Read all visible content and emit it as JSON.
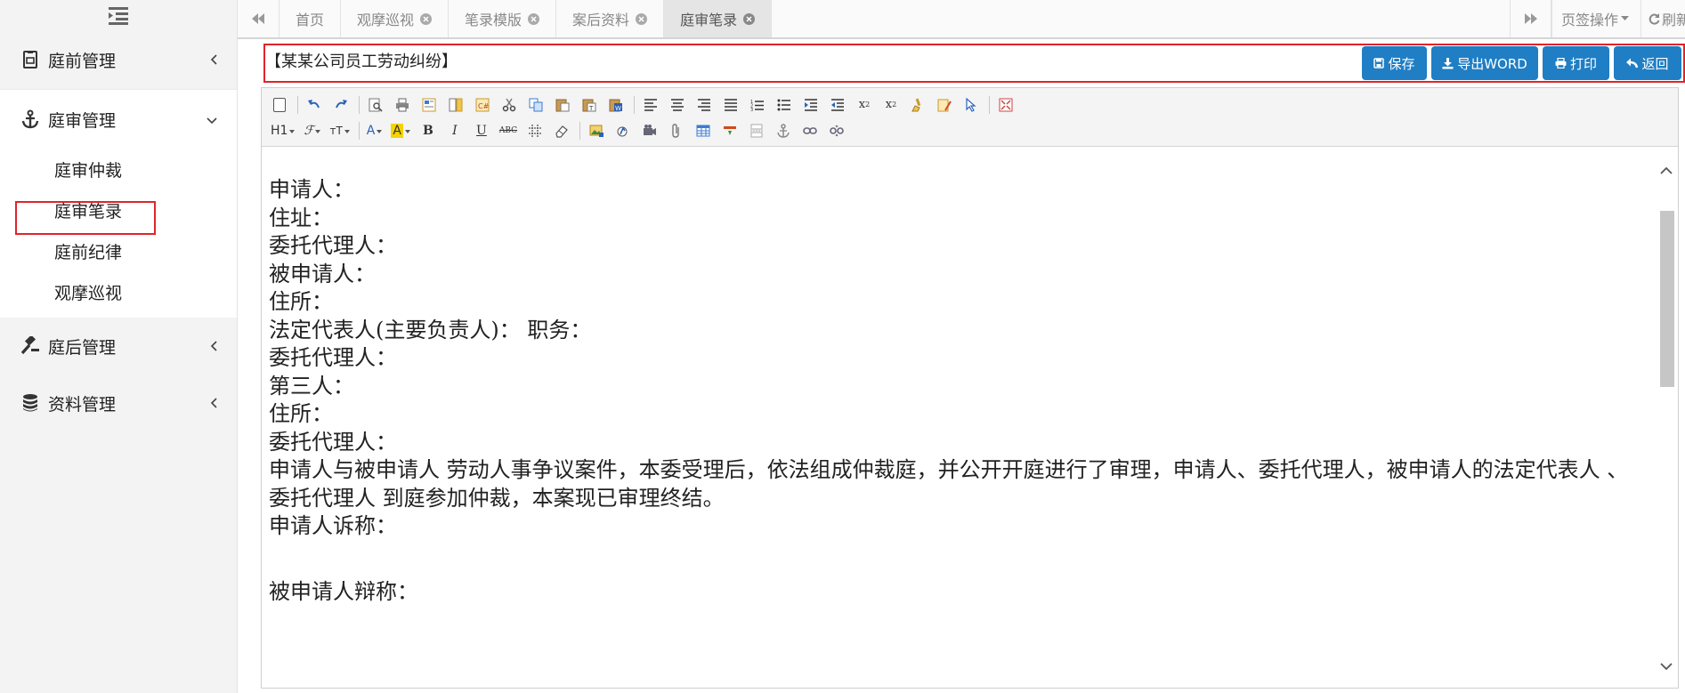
{
  "sidebar": {
    "groups": [
      {
        "label": "庭前管理",
        "icon": "document-icon",
        "chevron": "left"
      },
      {
        "label": "庭审管理",
        "icon": "anchor-icon",
        "chevron": "down",
        "items": [
          {
            "label": "庭审仲裁"
          },
          {
            "label": "庭审笔录"
          },
          {
            "label": "庭前纪律"
          },
          {
            "label": "观摩巡视"
          }
        ]
      },
      {
        "label": "庭后管理",
        "icon": "gavel-icon",
        "chevron": "left"
      },
      {
        "label": "资料管理",
        "icon": "database-icon",
        "chevron": "left"
      }
    ],
    "highlighted_item": "庭审笔录"
  },
  "tabs": [
    {
      "label": "首页",
      "closable": false
    },
    {
      "label": "观摩巡视",
      "closable": true
    },
    {
      "label": "笔录模版",
      "closable": true
    },
    {
      "label": "案后资料",
      "closable": true
    },
    {
      "label": "庭审笔录",
      "closable": true,
      "active": true
    }
  ],
  "tabbar_right": {
    "page_ops": "页签操作",
    "refresh": "刷新"
  },
  "document": {
    "title": "【某某公司员工劳动纠纷】",
    "buttons": {
      "save": "保存",
      "export_word": "导出WORD",
      "print": "打印",
      "back": "返回"
    }
  },
  "editor": {
    "heading_dd": "H1",
    "lines": [
      "申请人：",
      "住址：",
      "委托代理人：",
      "被申请人：",
      "住所：",
      "法定代表人(主要负责人)： 职务：",
      "委托代理人：",
      "第三人：",
      "住所：",
      "委托代理人：",
      "申请人与被申请人 劳动人事争议案件，本委受理后，依法组成仲裁庭，并公开开庭进行了审理，申请人、委托代理人，被申请人的法定代表人 、委托代理人 到庭参加仲裁，本案现已审理终结。",
      "申请人诉称：",
      "",
      "被申请人辩称："
    ]
  },
  "colors": {
    "primary_button": "#1f7ec4",
    "highlight_border": "#e0242a",
    "sidebar_bg": "#f3f3f3"
  }
}
